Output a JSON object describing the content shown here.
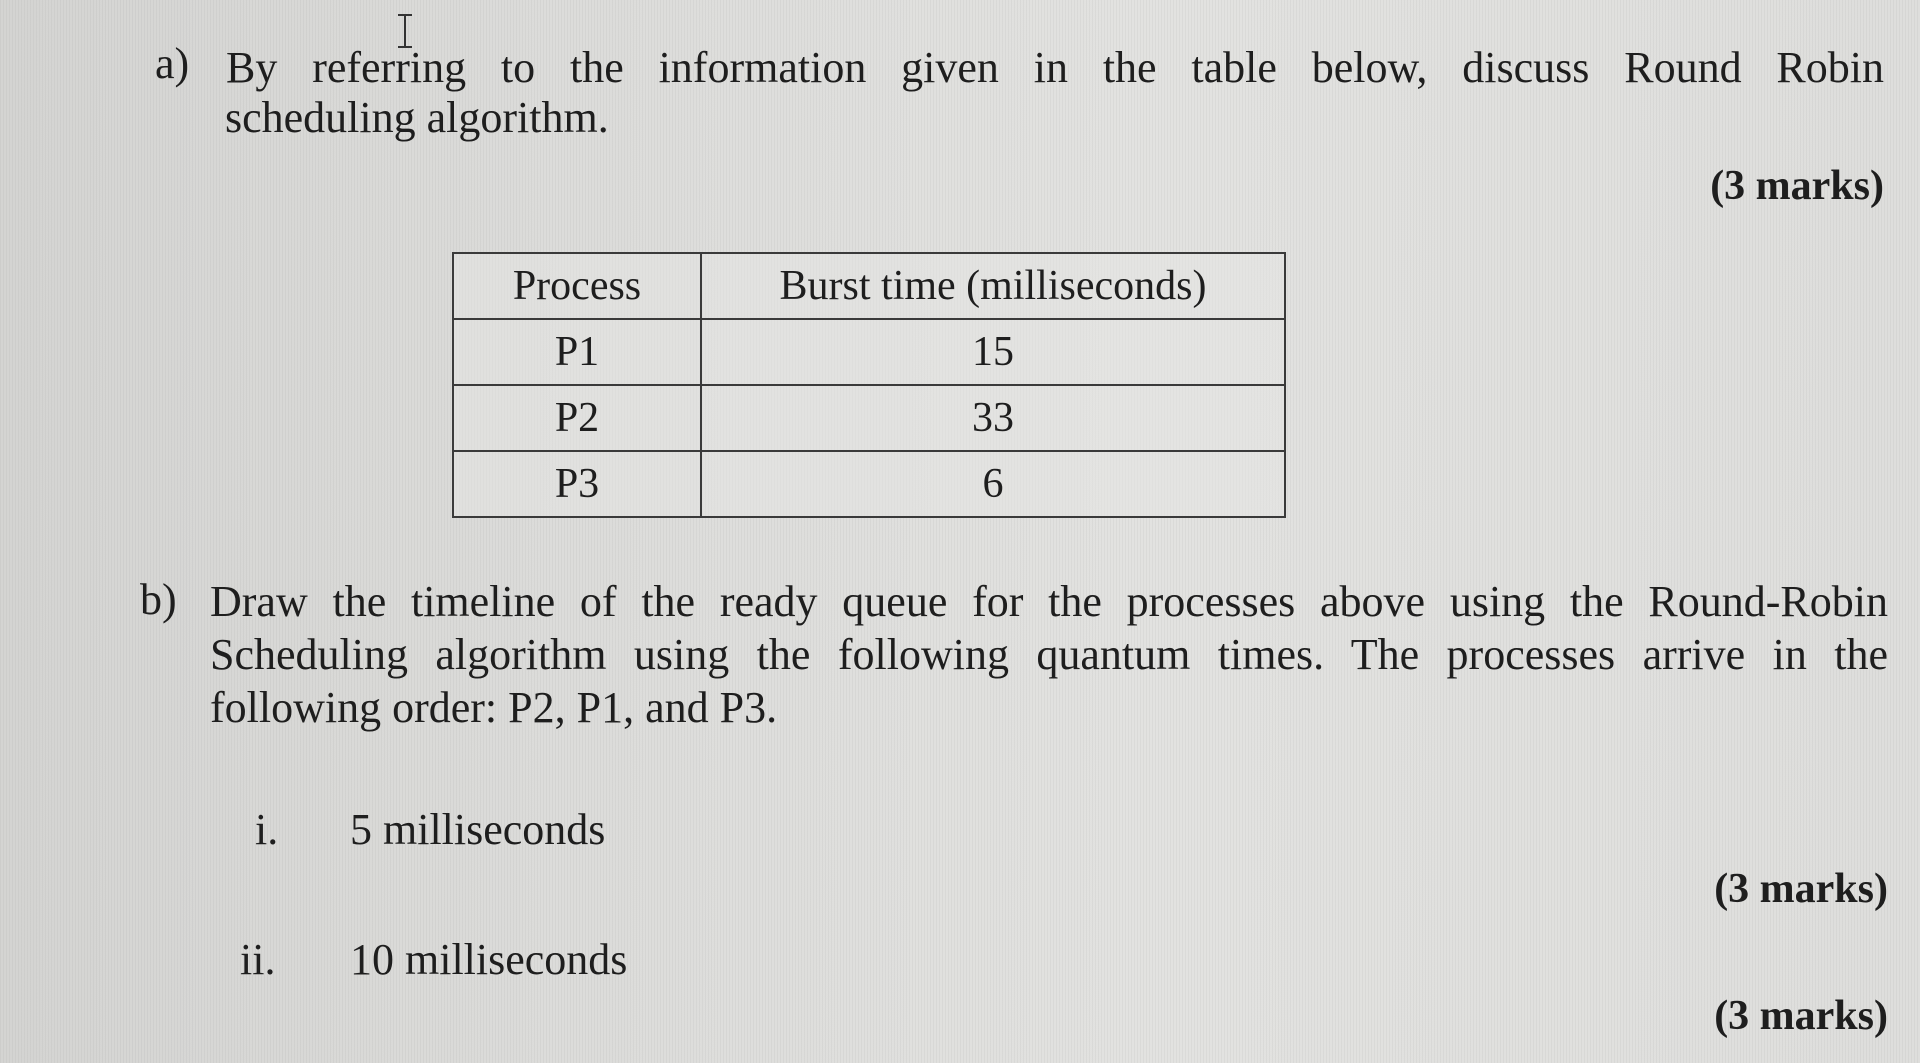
{
  "question_a": {
    "label": "a)",
    "line1": "By referring to the information given in the table below, discuss Round Robin",
    "line2": "scheduling algorithm.",
    "marks": "(3 marks)"
  },
  "table": {
    "headers": [
      "Process",
      "Burst time (milliseconds)"
    ],
    "rows": [
      {
        "process": "P1",
        "burst": "15"
      },
      {
        "process": "P2",
        "burst": "33"
      },
      {
        "process": "P3",
        "burst": "6"
      }
    ]
  },
  "question_b": {
    "label": "b)",
    "line1": "Draw the timeline of the ready queue for the processes above using the Round-Robin",
    "line2": "Scheduling algorithm using the following quantum times. The processes arrive in the",
    "line3": "following order: P2, P1, and P3.",
    "items": [
      {
        "label": "i.",
        "text": "5 milliseconds",
        "marks": "(3 marks)"
      },
      {
        "label": "ii.",
        "text": "10 milliseconds",
        "marks": "(3 marks)"
      }
    ]
  },
  "icons": {
    "text_cursor": "i-beam-cursor-icon"
  }
}
